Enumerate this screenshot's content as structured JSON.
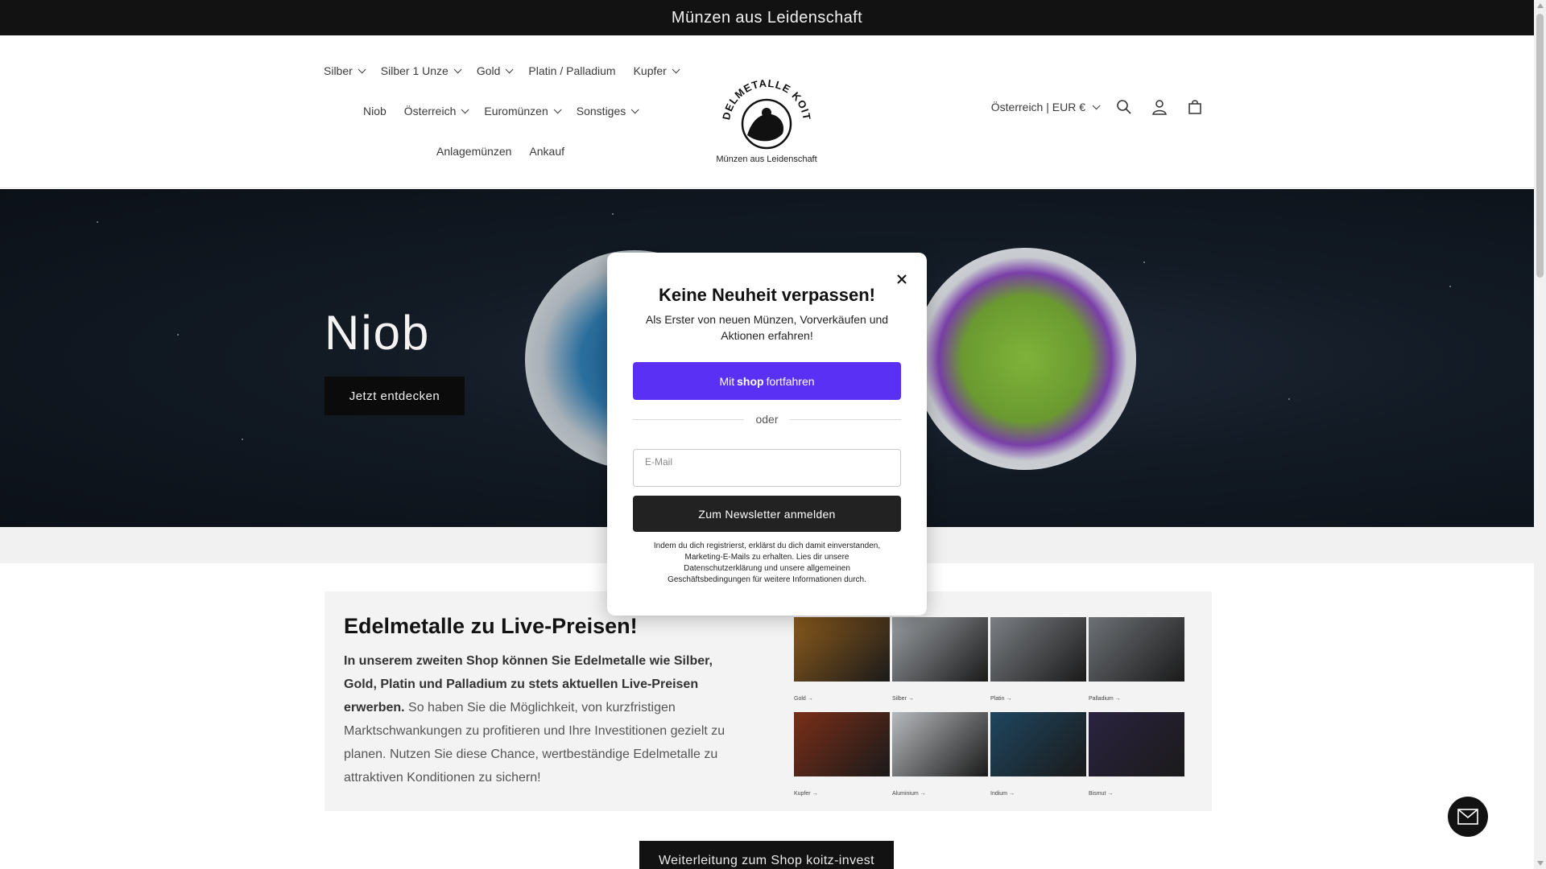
{
  "announcement": {
    "text": "Münzen aus Leidenschaft"
  },
  "header": {
    "nav_row1": [
      {
        "label": "Silber",
        "dropdown": true
      },
      {
        "label": "Silber 1 Unze",
        "dropdown": true
      },
      {
        "label": "Gold",
        "dropdown": true
      },
      {
        "label": "Platin / Palladium",
        "dropdown": false
      },
      {
        "label": "Kupfer",
        "dropdown": true
      }
    ],
    "nav_row2": [
      {
        "label": "Niob",
        "dropdown": false
      },
      {
        "label": "Österreich",
        "dropdown": true
      },
      {
        "label": "Euromünzen",
        "dropdown": true
      },
      {
        "label": "Sonstiges",
        "dropdown": true
      }
    ],
    "nav_row3": [
      {
        "label": "Anlagemünzen",
        "dropdown": false
      },
      {
        "label": "Ankauf",
        "dropdown": false
      }
    ],
    "logo": {
      "arc_text": "EDELMETALLE KOITZ",
      "subtitle": "Münzen aus Leidenschaft"
    },
    "country_selector": "Österreich | EUR €",
    "icons": [
      "search-icon",
      "account-icon",
      "cart-icon"
    ]
  },
  "hero": {
    "title": "Niob",
    "button": "Jetzt entdecken"
  },
  "promo": {
    "title": "Edelmetalle zu Live-Preisen!",
    "text_bold": "In unserem zweiten Shop können Sie Edelmetalle wie Silber, Gold, Platin und Palladium zu stets aktuellen Live-Preisen erwerben.",
    "text_rest": " So haben Sie die Möglichkeit, von kurzfristigen Marktschwankungen zu profitieren und Ihre Investitionen gezielt zu planen. Nutzen Sie diese Chance, wertbeständige Edelmetalle zu attraktiven Konditionen zu sichern!",
    "metals": [
      {
        "label": "Gold →",
        "color": "#8a5a1c"
      },
      {
        "label": "Silber →",
        "color": "#9a9ea3"
      },
      {
        "label": "Platin →",
        "color": "#7b7f84"
      },
      {
        "label": "Palladium →",
        "color": "#6d7176"
      },
      {
        "label": "Kupfer →",
        "color": "#7a2e18"
      },
      {
        "label": "Aluminium →",
        "color": "#b7babd"
      },
      {
        "label": "Indium →",
        "color": "#1f4660"
      },
      {
        "label": "Bismut →",
        "color": "#2b2340"
      }
    ],
    "redirect_button": "Weiterleitung zum Shop koitz-invest"
  },
  "modal": {
    "title": "Keine Neuheit verpassen!",
    "subtitle": "Als Erster von neuen Münzen, Vorverkäufen und Aktionen erfahren!",
    "shop_button_prefix": "Mit",
    "shop_button_brand": "shop",
    "shop_button_suffix": "fortfahren",
    "divider": "oder",
    "email_label": "E-Mail",
    "email_value": "",
    "subscribe_button": "Zum Newsletter anmelden",
    "legal": "Indem du dich registrierst, erklärst du dich damit einverstanden, Marketing-E-Mails zu erhalten. Lies dir unsere Datenschutzerklärung und unsere allgemeinen Geschäftsbedingungen für weitere Informationen durch."
  },
  "colors": {
    "shop_purple": "#5a31f4",
    "dark": "#121212"
  }
}
